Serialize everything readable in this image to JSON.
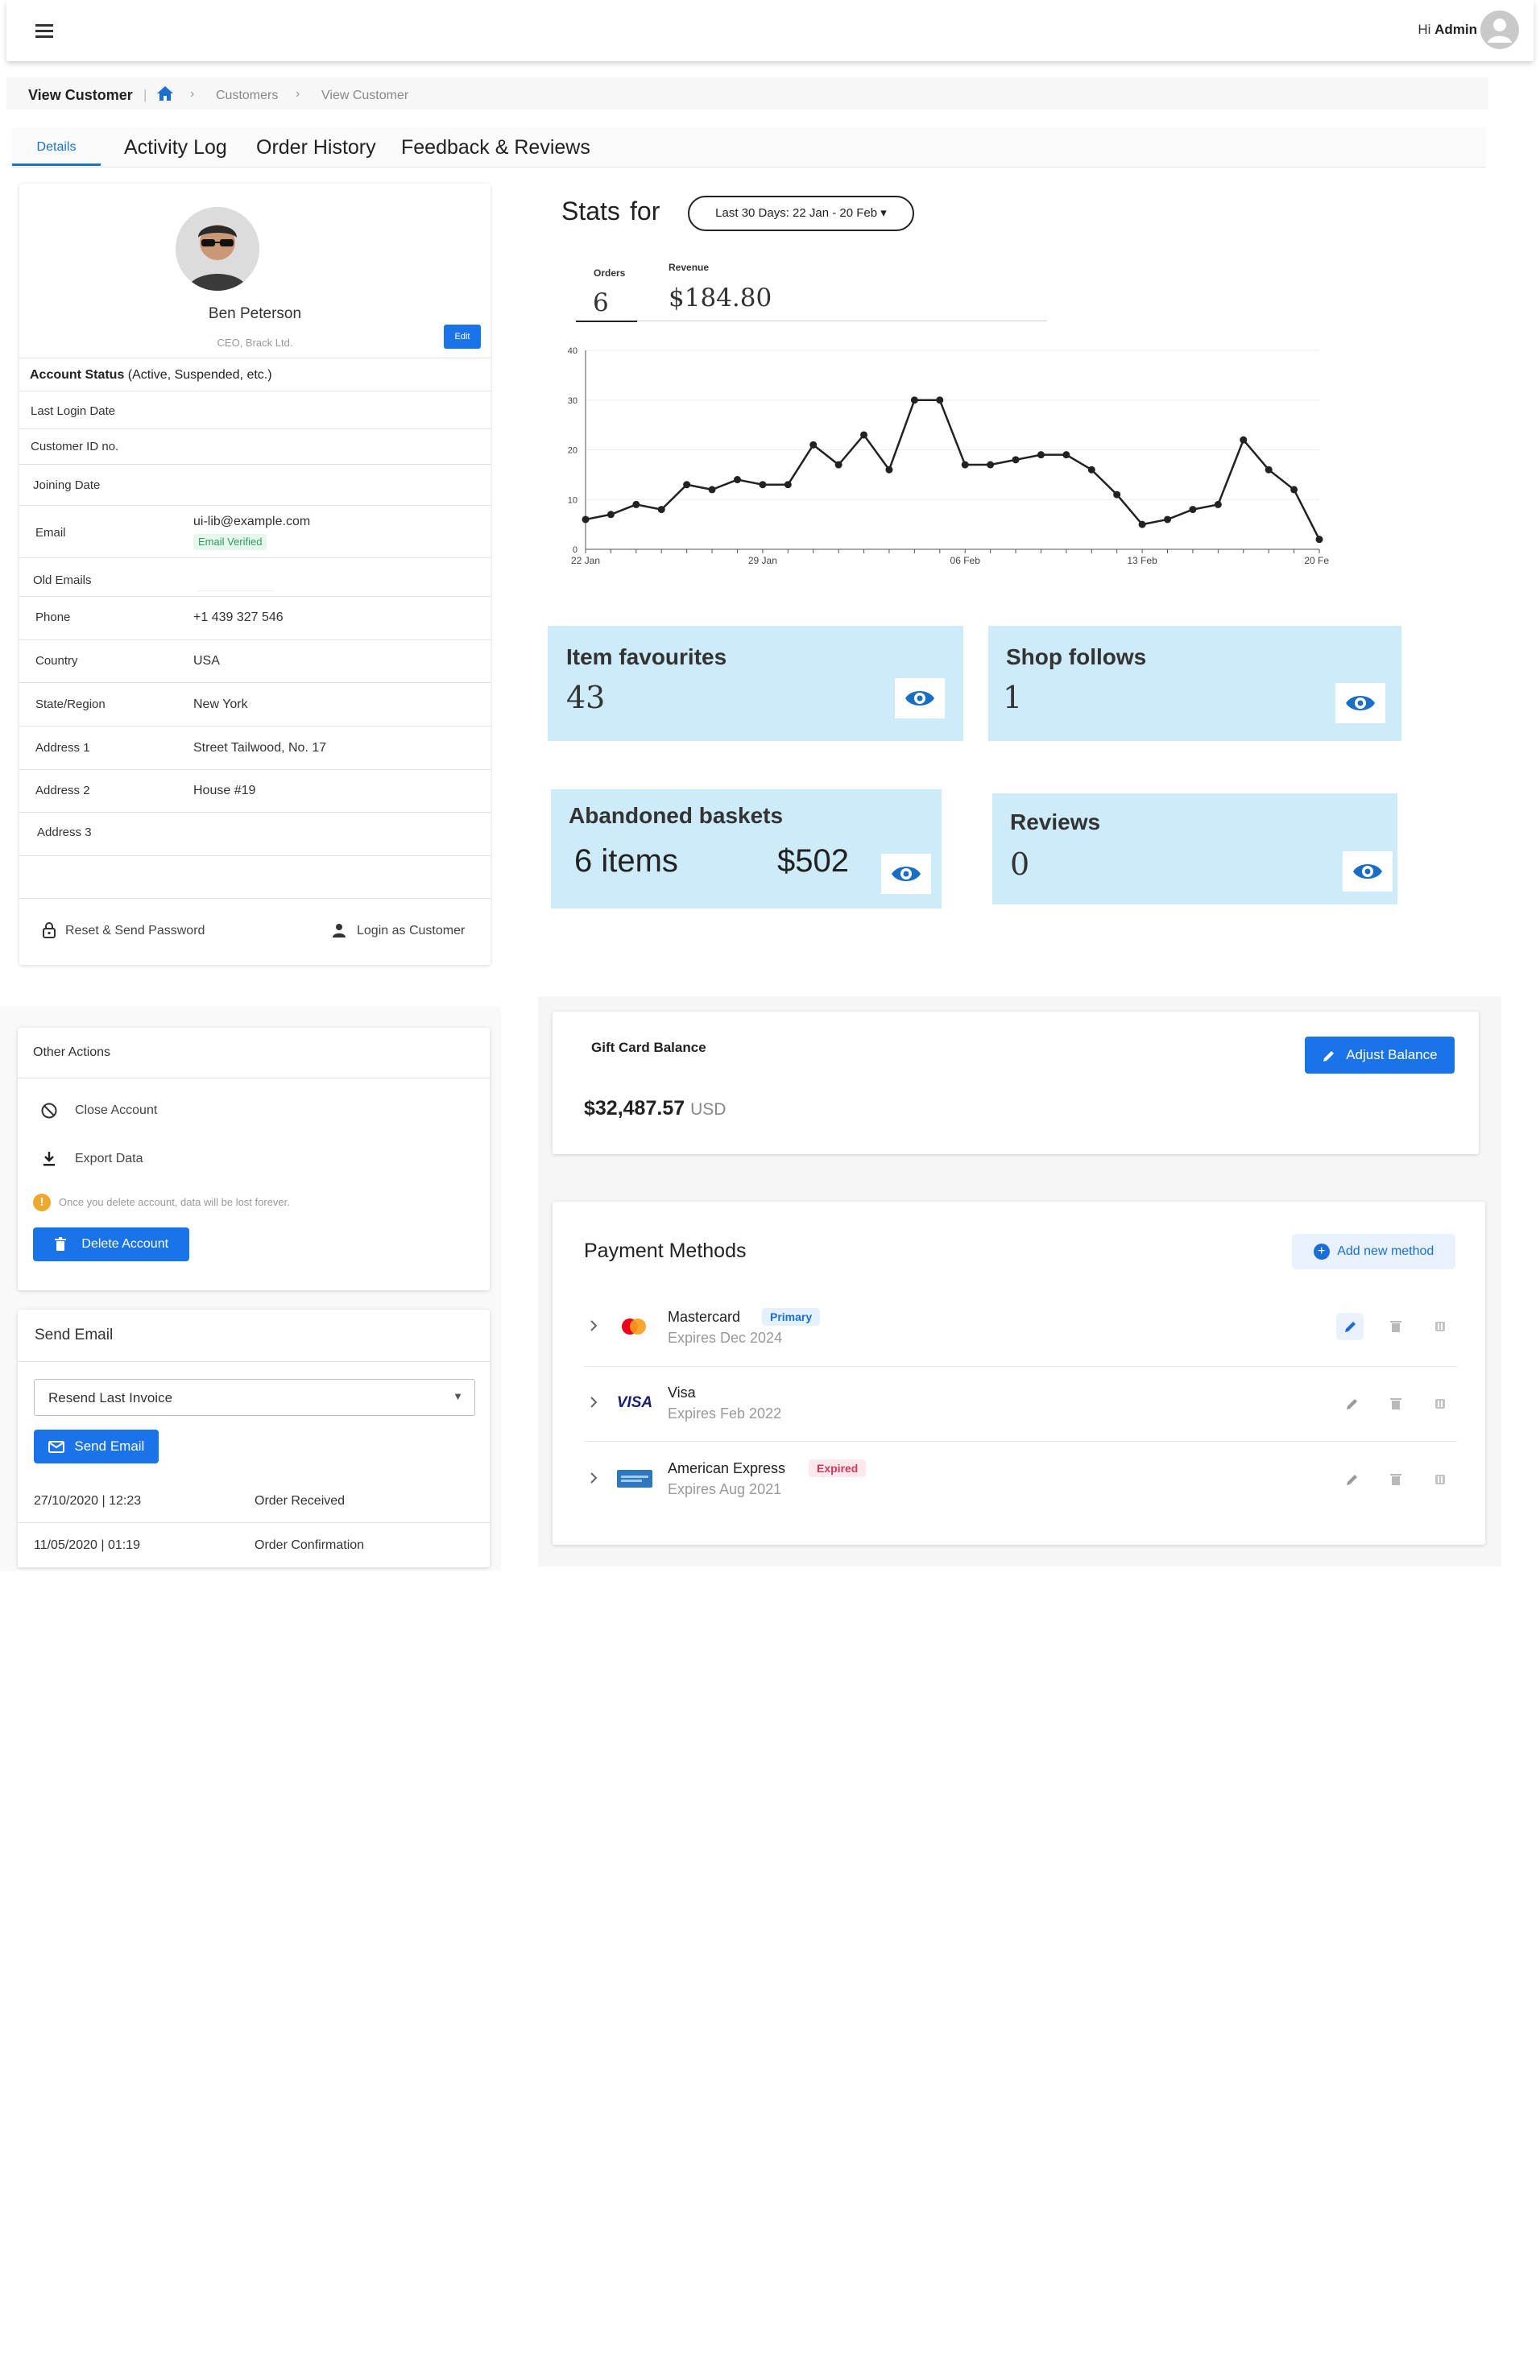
{
  "topbar": {
    "greeting": "Hi",
    "user": "Admin"
  },
  "breadcrumb": {
    "title": "View Customer",
    "items": [
      "Customers",
      "View Customer"
    ]
  },
  "tabs": [
    "Details",
    "Activity Log",
    "Order History",
    "Feedback & Reviews"
  ],
  "profile": {
    "name": "Ben Peterson",
    "title": "CEO, Brack Ltd.",
    "edit_label": "Edit",
    "status_label": "Account Status",
    "status_hint": "(Active, Suspended, etc.)",
    "fields": [
      {
        "label": "Last Login Date",
        "value": ""
      },
      {
        "label": "Customer ID no.",
        "value": ""
      },
      {
        "label": "Joining Date",
        "value": ""
      },
      {
        "label": "Email",
        "value": "ui-lib@example.com"
      },
      {
        "label": "Old Emails",
        "value": ""
      },
      {
        "label": "Phone",
        "value": "+1 439 327 546"
      },
      {
        "label": "Country",
        "value": "USA"
      },
      {
        "label": "State/Region",
        "value": "New York"
      },
      {
        "label": "Address 1",
        "value": "Street Tailwood, No. 17"
      },
      {
        "label": "Address 2",
        "value": "House #19"
      },
      {
        "label": "Address 3",
        "value": ""
      }
    ],
    "email_badge": "Email Verified",
    "reset_label": "Reset & Send Password",
    "login_label": "Login as Customer"
  },
  "other_actions": {
    "title": "Other Actions",
    "close_label": "Close Account",
    "export_label": "Export Data",
    "warning": "Once you delete account, data will be lost forever.",
    "delete_label": "Delete Account"
  },
  "send_email": {
    "title": "Send Email",
    "select_value": "Resend Last Invoice",
    "send_label": "Send Email",
    "log": [
      {
        "date": "27/10/2020 | 12:23",
        "event": "Order Received"
      },
      {
        "date": "11/05/2020 | 01:19",
        "event": "Order Confirmation"
      }
    ]
  },
  "stats": {
    "label_stats": "Stats",
    "label_for": "for",
    "range": "Last 30 Days: 22 Jan - 20 Feb",
    "orders_label": "Orders",
    "orders_value": "6",
    "revenue_label": "Revenue",
    "revenue_value": "$184.80"
  },
  "chart_data": {
    "type": "line",
    "x_ticks": [
      "22 Jan",
      "29 Jan",
      "06 Feb",
      "13 Feb",
      "20 Feb"
    ],
    "y_ticks": [
      "0",
      "10",
      "20",
      "30",
      "40"
    ],
    "ylim": [
      0,
      40
    ],
    "values": [
      6,
      7,
      9,
      8,
      13,
      12,
      14,
      13,
      13,
      21,
      17,
      23,
      16,
      30,
      30,
      17,
      17,
      18,
      19,
      19,
      16,
      11,
      5,
      6,
      8,
      9,
      22,
      16,
      12,
      2
    ],
    "grid": true,
    "color": "#222222"
  },
  "tiles": {
    "favourites": {
      "title": "Item favourites",
      "value": "43"
    },
    "follows": {
      "title": "Shop follows",
      "value": "1"
    },
    "baskets": {
      "title": "Abandoned baskets",
      "items": "6 items",
      "amount": "$502"
    },
    "reviews": {
      "title": "Reviews",
      "value": "0"
    },
    "color": "#cdebf8",
    "eye_color": "#1a6fc4"
  },
  "gift_card": {
    "title": "Gift Card Balance",
    "amount": "$32,487.57",
    "currency": "USD",
    "adjust_label": "Adjust Balance"
  },
  "payment": {
    "title": "Payment Methods",
    "add_label": "Add new method",
    "methods": [
      {
        "name": "Mastercard",
        "badge": "Primary",
        "expires": "Expires Dec 2024",
        "logo": "mastercard-logo"
      },
      {
        "name": "Visa",
        "badge": "",
        "expires": "Expires Feb 2022",
        "logo": "visa-logo",
        "logo_text": "VISA"
      },
      {
        "name": "American Express",
        "badge": "Expired",
        "expires": "Expires Aug 2021",
        "logo": "amex-logo"
      }
    ]
  },
  "colors": {
    "primary": "#1a73e8",
    "tile": "#cdebf8",
    "verified": "#2e9b5a",
    "expired": "#d0395b"
  }
}
